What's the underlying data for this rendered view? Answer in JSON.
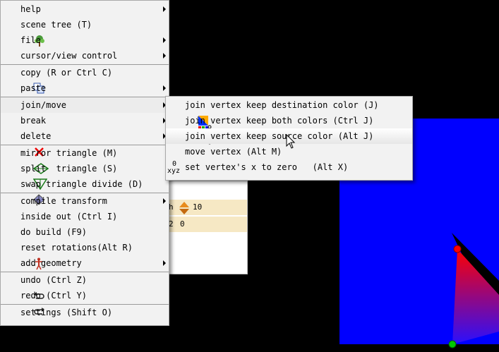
{
  "main_menu": [
    {
      "label": "help",
      "submenu": true,
      "icon": null
    },
    {
      "label": "scene tree (T)",
      "submenu": false,
      "icon": "tree-icon"
    },
    {
      "label": "file",
      "submenu": true,
      "icon": null
    },
    {
      "label": "cursor/view control",
      "submenu": true,
      "icon": null
    },
    {
      "label": "copy (R or Ctrl C)",
      "submenu": false,
      "icon": "copy-icon"
    },
    {
      "label": "paste",
      "submenu": true,
      "icon": "paste-icon"
    },
    {
      "label": "join/move",
      "submenu": true,
      "icon": null,
      "active": true
    },
    {
      "label": "break",
      "submenu": true,
      "icon": null
    },
    {
      "label": "delete",
      "submenu": true,
      "icon": "delete-x-icon"
    },
    {
      "label": "mirror triangle (M)",
      "submenu": false,
      "icon": "mirror-triangle-icon"
    },
    {
      "label": "split  triangle (S)",
      "submenu": false,
      "icon": "split-triangle-icon"
    },
    {
      "label": "swap triangle divide (D)",
      "submenu": false,
      "icon": "swap-divide-icon"
    },
    {
      "label": "compile transform",
      "submenu": true,
      "icon": null
    },
    {
      "label": "inside out (Ctrl I)",
      "submenu": false,
      "icon": null
    },
    {
      "label": "do build (F9)",
      "submenu": false,
      "icon": null
    },
    {
      "label": "reset rotations(Alt R)",
      "submenu": false,
      "icon": "figure-icon"
    },
    {
      "label": "add geometry",
      "submenu": true,
      "icon": null
    },
    {
      "label": "undo (Ctrl Z)",
      "submenu": false,
      "icon": "undo-icon"
    },
    {
      "label": "redo (Ctrl Y)",
      "submenu": false,
      "icon": "redo-icon"
    },
    {
      "label": "settings (Shift O)",
      "submenu": false,
      "icon": null
    }
  ],
  "sub_menu": [
    {
      "label": "join vertex keep destination color (J)",
      "icon": "join-dest-color-icon"
    },
    {
      "label": "join vertex keep both colors (Ctrl J)",
      "icon": "join-both-colors-icon"
    },
    {
      "label": "join vertex keep source color (Alt J)",
      "icon": null,
      "hover": true
    },
    {
      "label": "move vertex (Alt M)",
      "icon": null
    },
    {
      "label": "set vertex's x to zero   (Alt X)",
      "icon": "xyz-zero-icon"
    }
  ],
  "xyz_icon": {
    "top": "0",
    "bottom": "xyz"
  },
  "background_panel": {
    "row1_left": "h",
    "row1_value": "10",
    "row2_left": "2",
    "row2_value": "0"
  },
  "colors": {
    "canvas_blue": "#0000ff",
    "background": "#000000",
    "menu_bg": "#f2f2f2",
    "vertex_red": "#ff0000",
    "vertex_green": "#00c000"
  }
}
